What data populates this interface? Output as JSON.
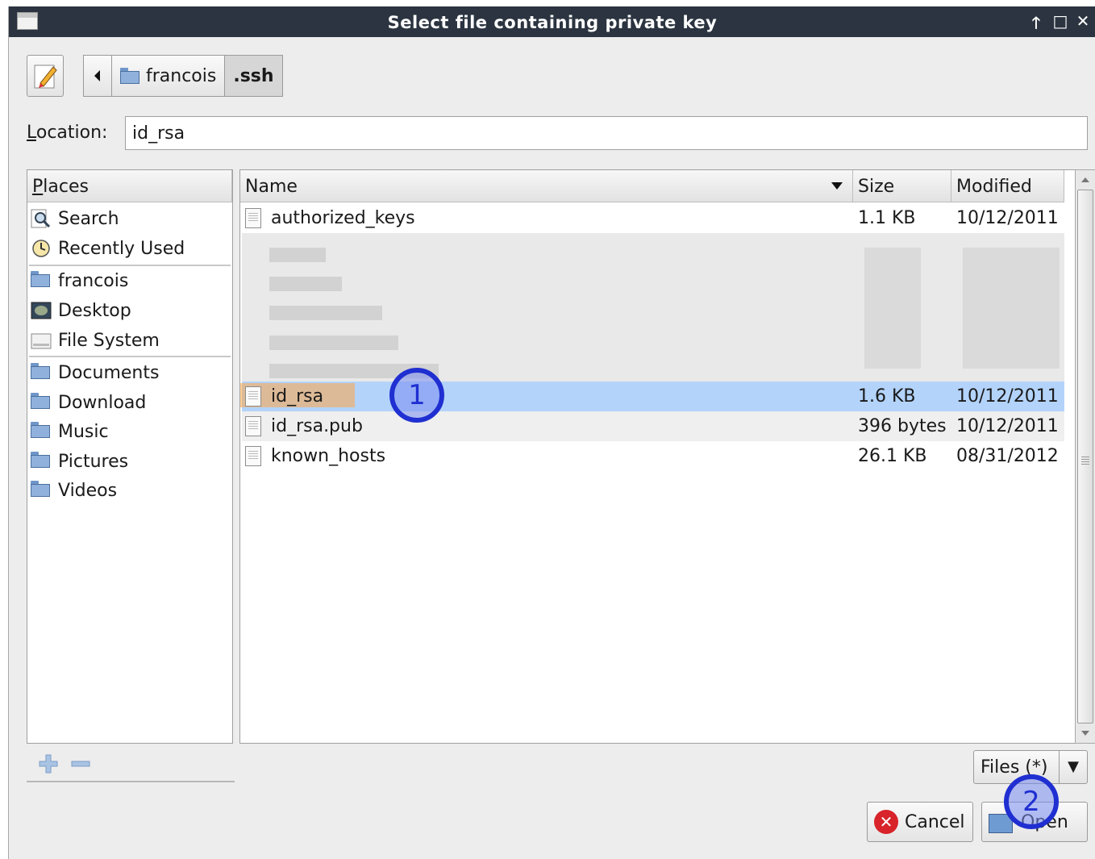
{
  "window": {
    "title": "Select file containing private key",
    "controls": [
      "🡑",
      "□",
      "✕"
    ]
  },
  "path": {
    "segments": [
      "francois",
      ".ssh"
    ],
    "active": ".ssh"
  },
  "location": {
    "label": "Location:",
    "value": "id_rsa"
  },
  "places": {
    "header": "Places",
    "items": [
      {
        "label": "Search",
        "icon": "search-icon"
      },
      {
        "label": "Recently Used",
        "icon": "clock-icon"
      },
      {
        "label": "francois",
        "icon": "home-folder-icon"
      },
      {
        "label": "Desktop",
        "icon": "desktop-icon"
      },
      {
        "label": "File System",
        "icon": "drive-icon"
      },
      {
        "label": "Documents",
        "icon": "folder-icon"
      },
      {
        "label": "Download",
        "icon": "folder-icon"
      },
      {
        "label": "Music",
        "icon": "folder-icon"
      },
      {
        "label": "Pictures",
        "icon": "folder-icon"
      },
      {
        "label": "Videos",
        "icon": "folder-icon"
      }
    ]
  },
  "files": {
    "columns": [
      "Name",
      "Size",
      "Modified"
    ],
    "rows": [
      {
        "name": "authorized_keys",
        "size": "1.1 KB",
        "modified": "10/12/2011"
      },
      {
        "name": "id_rsa",
        "size": "1.6 KB",
        "modified": "10/12/2011"
      },
      {
        "name": "id_rsa.pub",
        "size": "396 bytes",
        "modified": "10/12/2011"
      },
      {
        "name": "known_hosts",
        "size": "26.1 KB",
        "modified": "08/31/2012"
      }
    ]
  },
  "filter": {
    "label": "Files (*)"
  },
  "buttons": {
    "cancel": "Cancel",
    "open": "Open"
  },
  "annotations": [
    "1",
    "2"
  ],
  "colors": {
    "titlebar": "#2b3440",
    "selection": "#b3d3fa",
    "highlight": "#ffa546",
    "badge": "#1f2fd1"
  }
}
